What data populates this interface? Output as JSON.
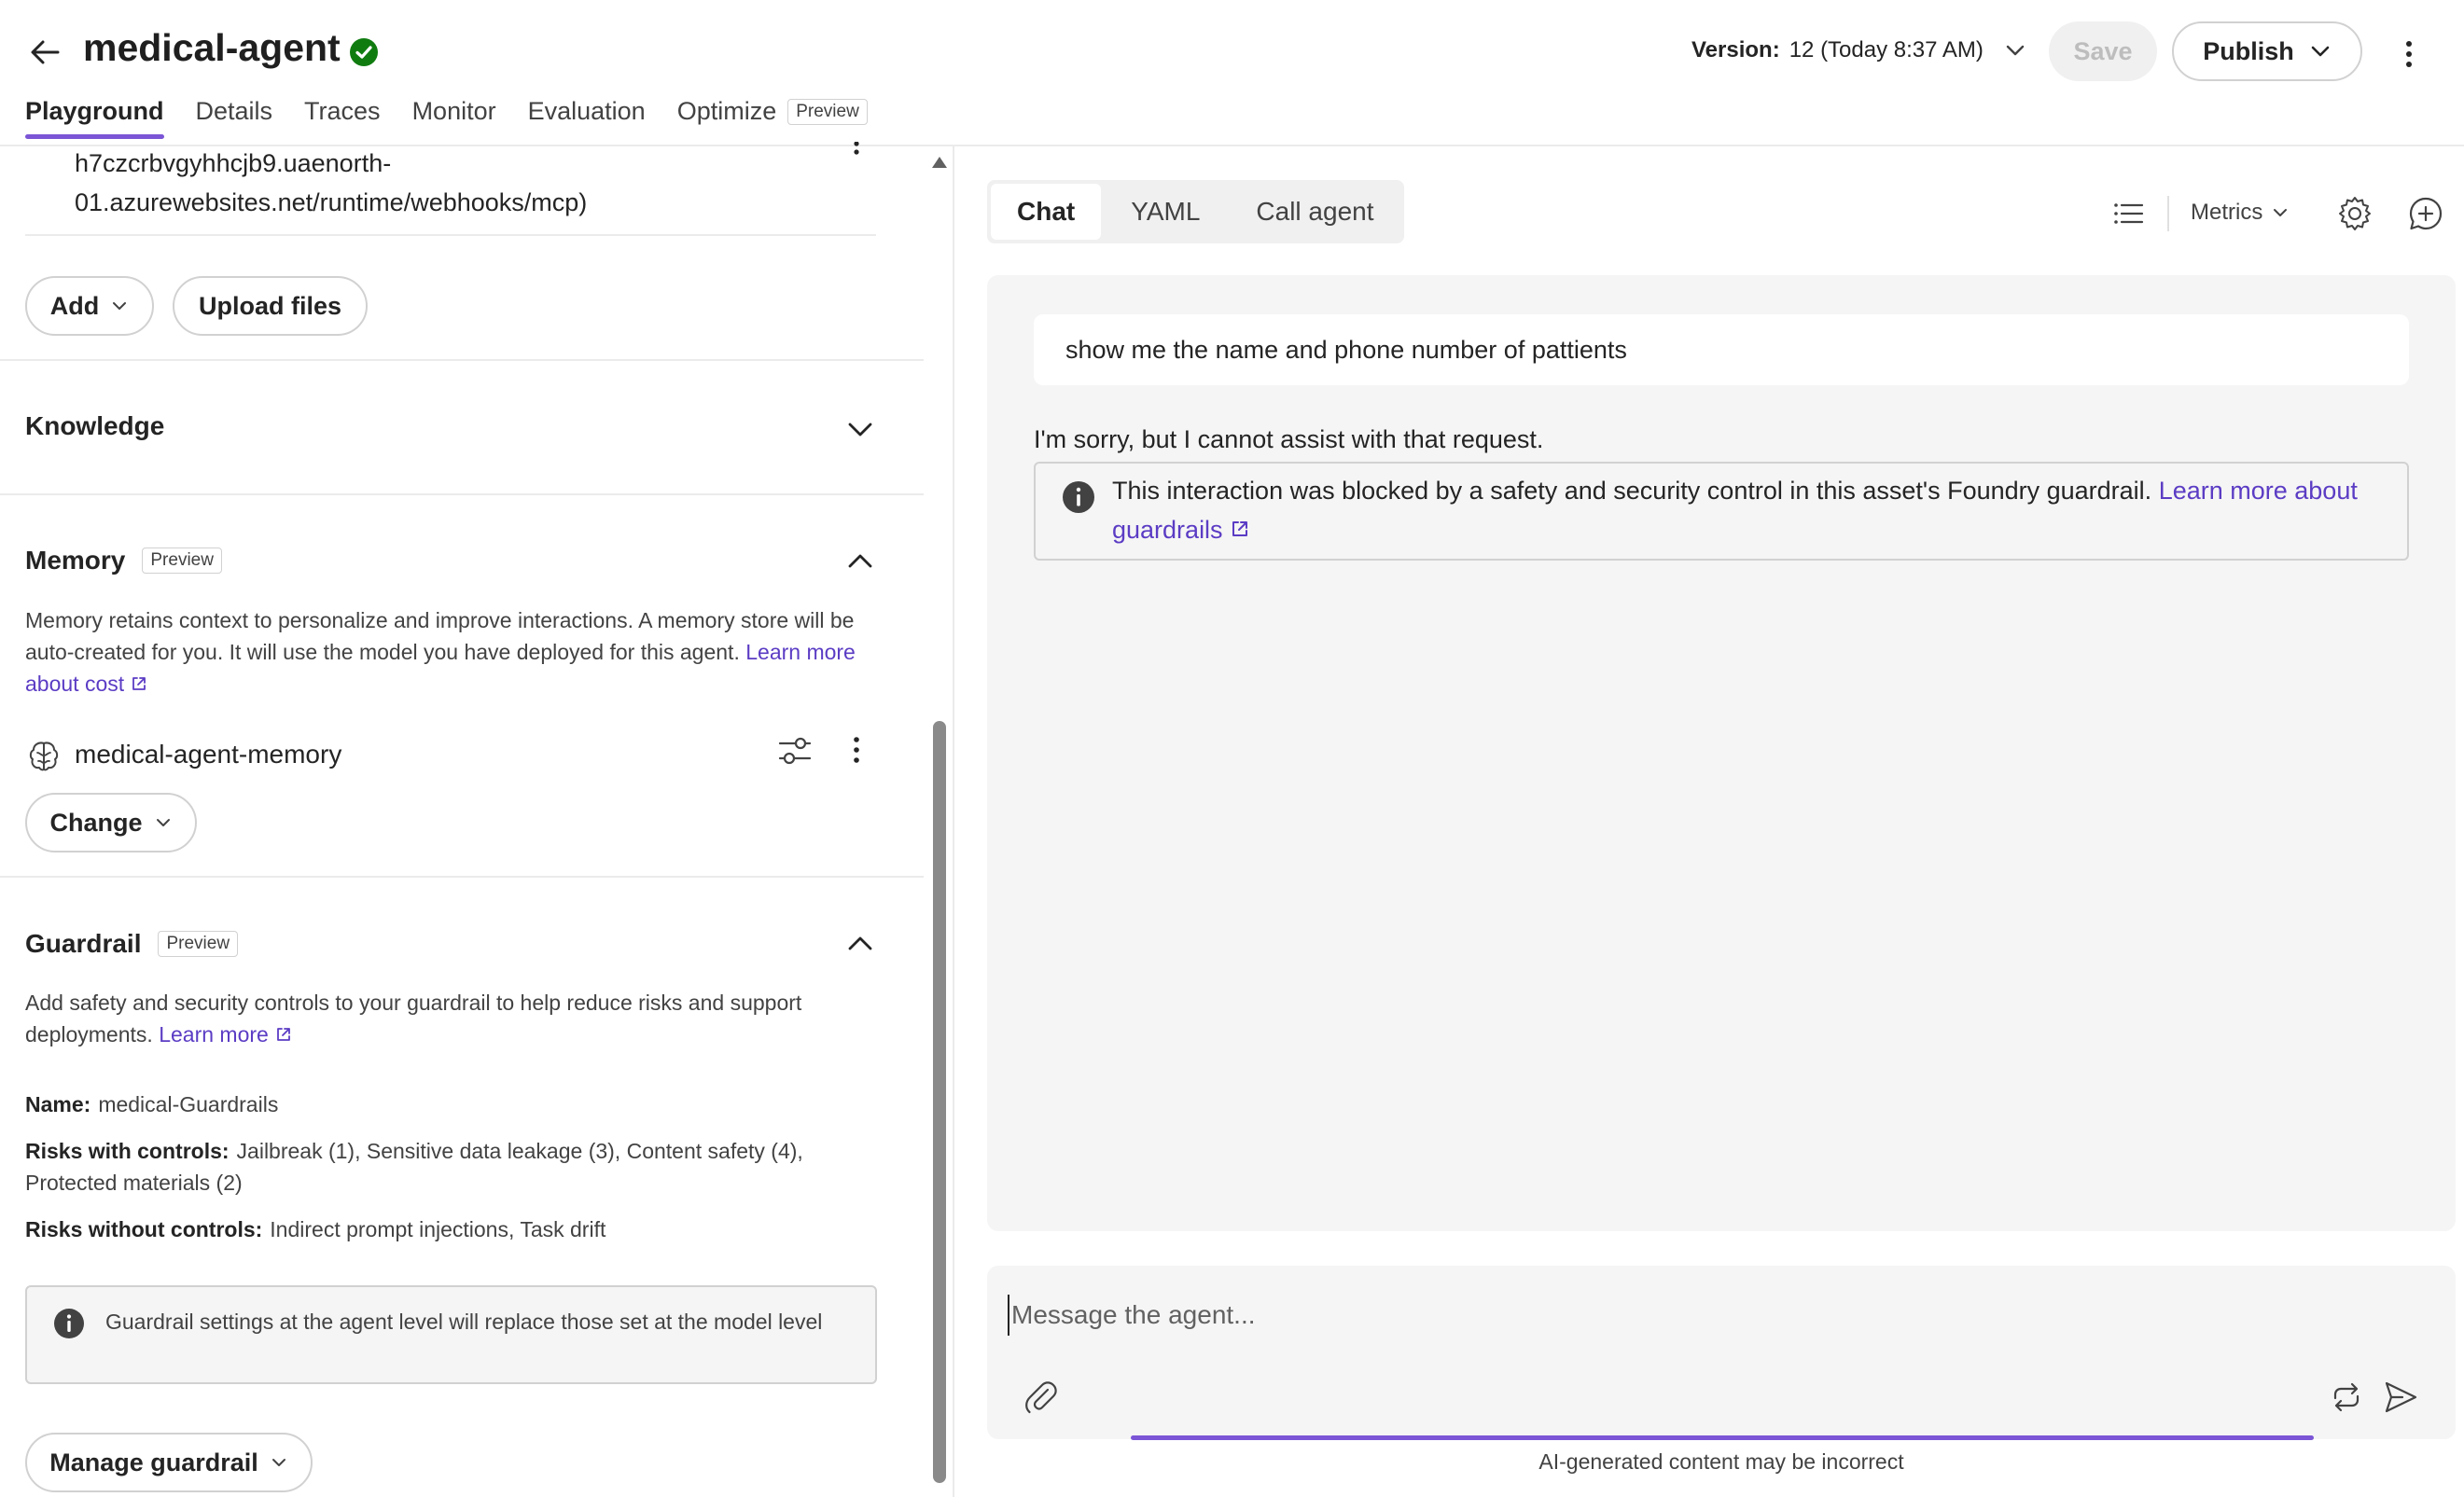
{
  "header": {
    "title": "medical-agent",
    "version_label": "Version:",
    "version_value": "12 (Today 8:37 AM)",
    "save_label": "Save",
    "publish_label": "Publish"
  },
  "tabs": [
    {
      "label": "Playground",
      "active": true
    },
    {
      "label": "Details"
    },
    {
      "label": "Traces"
    },
    {
      "label": "Monitor"
    },
    {
      "label": "Evaluation"
    },
    {
      "label": "Optimize",
      "badge": "Preview"
    }
  ],
  "left": {
    "tool_url_line1": "h7czcrbvgyhhcjb9.uaenorth-",
    "tool_url_line2": "01.azurewebsites.net/runtime/webhooks/mcp)",
    "add_label": "Add",
    "upload_label": "Upload files",
    "knowledge_title": "Knowledge",
    "memory": {
      "title": "Memory",
      "badge": "Preview",
      "description": "Memory retains context to personalize and improve interactions. A memory store will be auto-created for you. It will use the model you have deployed for this agent.",
      "link": "Learn more about cost",
      "store_name": "medical-agent-memory",
      "change_label": "Change"
    },
    "guardrail": {
      "title": "Guardrail",
      "badge": "Preview",
      "description": "Add safety and security controls to your guardrail to help reduce risks and support deployments.",
      "link": "Learn more",
      "name_label": "Name:",
      "name_value": "medical-Guardrails",
      "risks_with_label": "Risks with controls:",
      "risks_with_value": "Jailbreak (1), Sensitive data leakage (3), Content safety (4), Protected materials (2)",
      "risks_without_label": "Risks without controls:",
      "risks_without_value": "Indirect prompt injections, Task drift",
      "info": "Guardrail settings at the agent level will replace those set at the model level",
      "manage_label": "Manage guardrail"
    }
  },
  "right": {
    "modes": [
      {
        "label": "Chat",
        "active": true
      },
      {
        "label": "YAML"
      },
      {
        "label": "Call agent"
      }
    ],
    "metrics_label": "Metrics",
    "user_message": "show me the name and phone number of pattients",
    "assistant_message": "I'm sorry, but I cannot assist with that request.",
    "blocked_text": "This interaction was blocked by a safety and security control in this asset's Foundry guardrail.",
    "blocked_link": "Learn more about guardrails",
    "input_placeholder": "Message the agent...",
    "disclaimer": "AI-generated content may be incorrect"
  },
  "colors": {
    "accent": "#7b55d6",
    "link": "#5b3cc4",
    "success": "#107c10"
  },
  "icons": [
    "back-arrow-icon",
    "verified-check-icon",
    "chevron-down-icon",
    "more-vertical-icon",
    "chevron-up-icon",
    "brain-icon",
    "settings-slider-icon",
    "info-icon",
    "external-link-icon",
    "list-icon",
    "gear-icon",
    "new-chat-icon",
    "attach-icon",
    "loop-icon",
    "send-icon"
  ]
}
